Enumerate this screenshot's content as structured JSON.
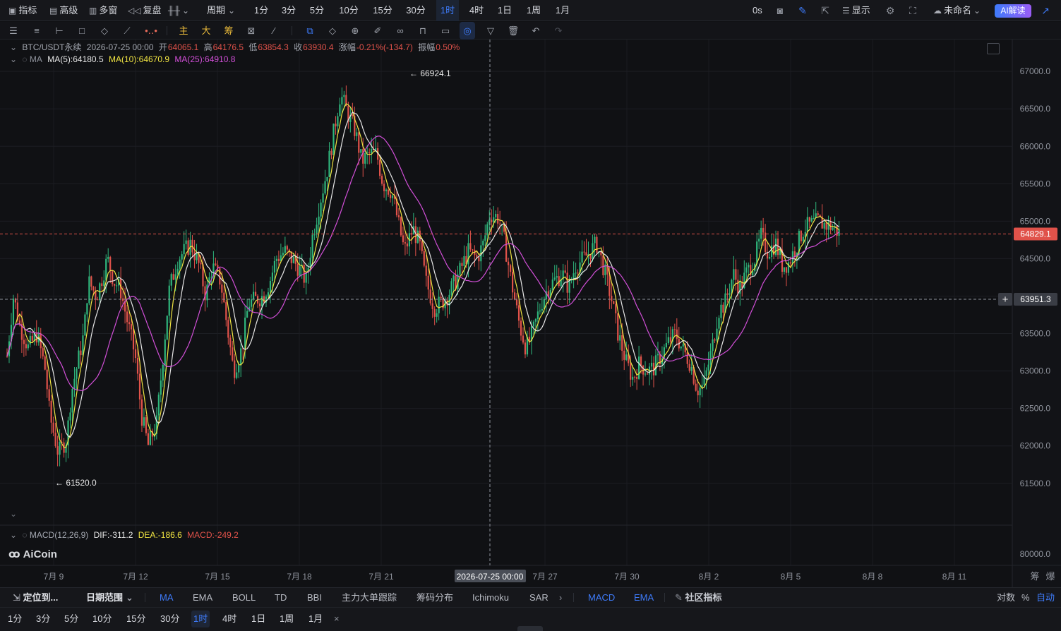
{
  "topbar": {
    "left_items": [
      {
        "icon": "indicator-icon",
        "label": "指标"
      },
      {
        "icon": "advanced-icon",
        "label": "高级"
      },
      {
        "icon": "multi-window-icon",
        "label": "多窗"
      },
      {
        "icon": "replay-icon",
        "label": "复盘"
      },
      {
        "icon": "chart-type-icon",
        "label": ""
      },
      {
        "icon": "",
        "label": "周期"
      }
    ],
    "timeframes": [
      "1分",
      "3分",
      "5分",
      "10分",
      "15分",
      "30分",
      "1时",
      "4时",
      "1日",
      "1周",
      "1月"
    ],
    "active_timeframe": "1时",
    "countdown": "0s",
    "display_label": "显示",
    "layout_name": "未命名",
    "ai_button": "AI解读"
  },
  "drawbar": {
    "cn_tools": [
      "主",
      "大",
      "筹"
    ]
  },
  "legend": {
    "symbol": "BTC/USDT永续",
    "time": "2026-07-25 00:00",
    "open_label": "开",
    "open": "64065.1",
    "high_label": "高",
    "high": "64176.5",
    "low_label": "低",
    "low": "63854.3",
    "close_label": "收",
    "close": "63930.4",
    "change_label": "涨幅",
    "change": "-0.21%(-134.7)",
    "amp_label": "振幅",
    "amp": "0.50%",
    "ma_name": "MA",
    "ma5": "MA(5):64180.5",
    "ma10": "MA(10):64670.9",
    "ma25": "MA(25):64910.8",
    "macd_name": "MACD(12,26,9)",
    "dif": "DIF:-311.2",
    "dea": "DEA:-186.6",
    "macd": "MACD:-249.2",
    "brand": "AiCoin"
  },
  "chart_data": {
    "type": "line",
    "title": "BTC/USDT永续",
    "y_ticks": [
      "67000.0",
      "66500.0",
      "66000.0",
      "65500.0",
      "65000.0",
      "64500.0",
      "64000.0",
      "63500.0",
      "63000.0",
      "62500.0",
      "62000.0",
      "61500.0"
    ],
    "macd_tick": "80000.0",
    "x_ticks": [
      "7月 9",
      "7月 12",
      "7月 15",
      "7月 18",
      "7月 21",
      "7月 27",
      "7月 30",
      "8月 2",
      "8月 5",
      "8月 8",
      "8月 11"
    ],
    "ylim": [
      61300,
      67350
    ],
    "price_line": 64829.1,
    "price_label": "64829.1",
    "cursor_price": "63951.3",
    "cursor_time": "2026-07-25 00:00",
    "high_mark": "66924.1",
    "low_mark": "61520.0",
    "axis_corner": [
      "筹",
      "爆"
    ],
    "series": [
      {
        "name": "MA(5)",
        "color": "#f0e442"
      },
      {
        "name": "MA(10)",
        "color": "#e8e8e8"
      },
      {
        "name": "MA(25)",
        "color": "#d24fd8"
      }
    ],
    "price_path_days": [
      0,
      0.3,
      0.6,
      1,
      1.4,
      1.8,
      2,
      2.4,
      2.8,
      3,
      3.3,
      3.6,
      3.8,
      4,
      4.2,
      4.5,
      4.7,
      5,
      5.3,
      5.6,
      6,
      6.3,
      6.6,
      7,
      7.3,
      7.6,
      8,
      8.3,
      8.6,
      9,
      9.3,
      9.6,
      10,
      10.3,
      10.6,
      11,
      11.3,
      11.6,
      12,
      12.3,
      12.6,
      13,
      13.3,
      13.6,
      14,
      14.3,
      14.6,
      15,
      15.3,
      15.6,
      16,
      16.3,
      16.6,
      17,
      17.3,
      17.6,
      18,
      18.3,
      18.6,
      19,
      19.3,
      19.6,
      20,
      20.3,
      20.6,
      21,
      21.3,
      21.6,
      22,
      22.3,
      22.6,
      23,
      23.3,
      23.6,
      24,
      24.3,
      24.6,
      25,
      25.3,
      25.6,
      26,
      26.3,
      26.6,
      27,
      27.3,
      27.6,
      28,
      28.3,
      28.6,
      29,
      29.3,
      29.6,
      30,
      30.3,
      30.6,
      31,
      31.3,
      31.6,
      32,
      32.3,
      32.6,
      33,
      33.3,
      33.6,
      34,
      34.3,
      34.6,
      35,
      35.3,
      35.6,
      36,
      36.3,
      36.6,
      37,
      37.3,
      37.6,
      38,
      38.3,
      38.6,
      39,
      39.3,
      39.6,
      40,
      40.3,
      40.6,
      41,
      41.3,
      41.6,
      42,
      42.3
    ],
    "price_path": [
      63200,
      64000,
      63600,
      63300,
      63500,
      63000,
      62400,
      61900,
      62100,
      62700,
      63100,
      63500,
      64200,
      64100,
      64000,
      64300,
      64500,
      64200,
      64100,
      63700,
      63200,
      62400,
      62000,
      62300,
      63200,
      64100,
      64500,
      64600,
      64700,
      64400,
      64000,
      64400,
      64200,
      63600,
      63000,
      63300,
      63900,
      63950,
      64000,
      64200,
      64500,
      64600,
      64500,
      64400,
      64200,
      64800,
      65200,
      65700,
      66200,
      66700,
      66400,
      66200,
      65800,
      65900,
      65900,
      65500,
      65400,
      65000,
      64600,
      64900,
      64700,
      64200,
      63850,
      63900,
      64000,
      64200,
      64400,
      64600,
      64500,
      64700,
      65100,
      65050,
      64700,
      64200,
      63600,
      63300,
      63500,
      63900,
      64100,
      64200,
      64300,
      64100,
      64400,
      64500,
      64600,
      64700,
      64300,
      63950,
      63500,
      63100,
      62900,
      63100,
      63000,
      63050,
      63200,
      63400,
      63500,
      63300,
      63100,
      62750,
      62800,
      63300,
      63800,
      63900,
      64300,
      64100,
      64300,
      64500,
      64800,
      64600,
      64700,
      64400,
      64450,
      64700,
      64900,
      64950,
      65000,
      64950,
      64930,
      64829
    ]
  },
  "bottom": {
    "locate": "定位到...",
    "date_range": "日期范围",
    "indicators": [
      "MA",
      "EMA",
      "BOLL",
      "TD",
      "BBI",
      "主力大单跟踪",
      "筹码分布",
      "Ichimoku",
      "SAR"
    ],
    "active_indicator": "MA",
    "sub_indicators": [
      "MACD",
      "EMA"
    ],
    "community": "社区指标",
    "scale": [
      "对数",
      "%",
      "自动"
    ],
    "timeframes": [
      "1分",
      "3分",
      "5分",
      "10分",
      "15分",
      "30分",
      "1时",
      "4时",
      "1日",
      "1周",
      "1月"
    ],
    "active_timeframe": "1时"
  }
}
